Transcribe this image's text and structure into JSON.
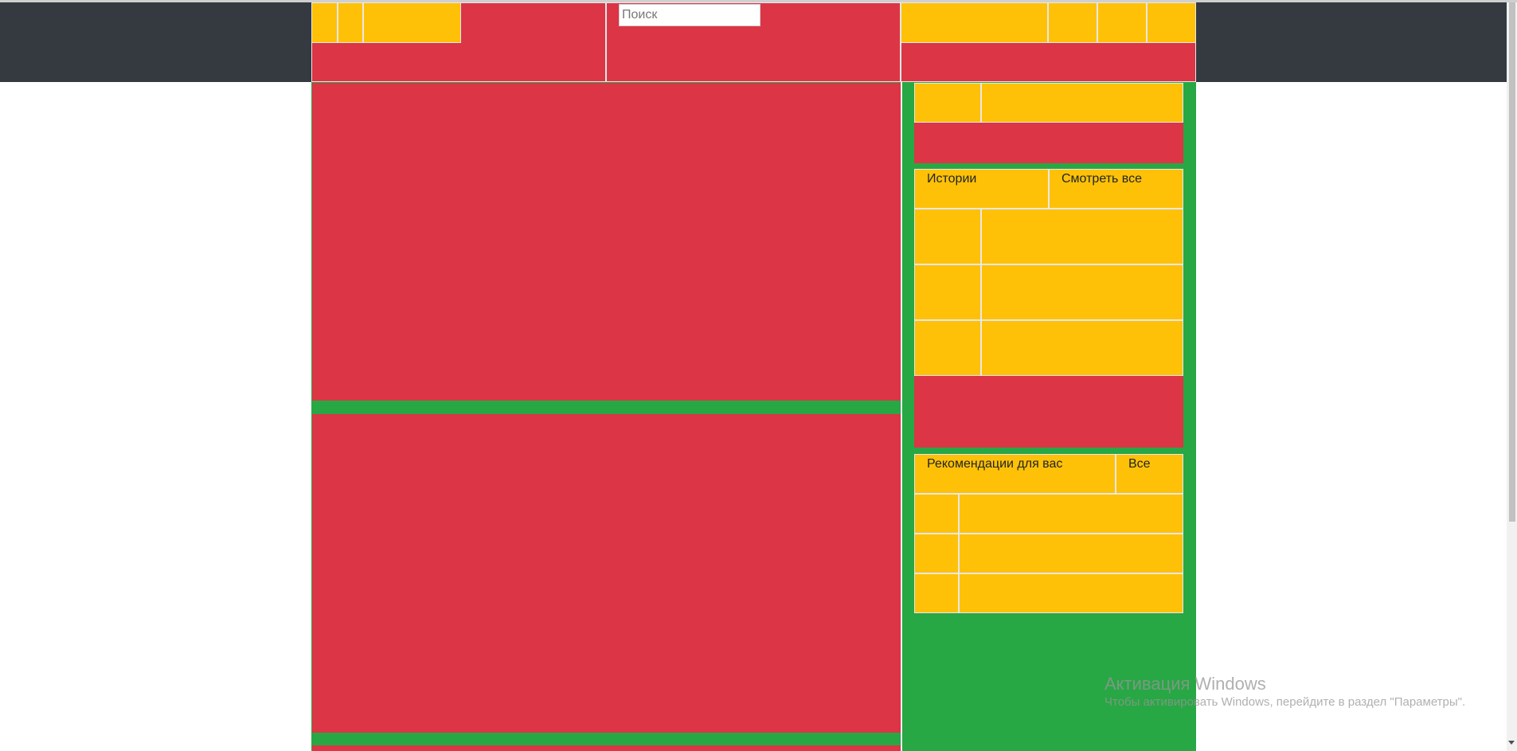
{
  "header": {
    "search": {
      "placeholder": "Поиск",
      "value": ""
    }
  },
  "sidebar": {
    "stories": {
      "title": "Истории",
      "see_all": "Смотреть все"
    },
    "recommendations": {
      "title": "Рекомендации для вас",
      "all": "Все"
    }
  },
  "overlay": {
    "activation_title": "Активация Windows",
    "activation_text": "Чтобы активировать Windows, перейдите в раздел \"Параметры\"."
  },
  "colors": {
    "dark": "#343a40",
    "red": "#dc3545",
    "green": "#28a745",
    "yellow": "#ffc107"
  }
}
